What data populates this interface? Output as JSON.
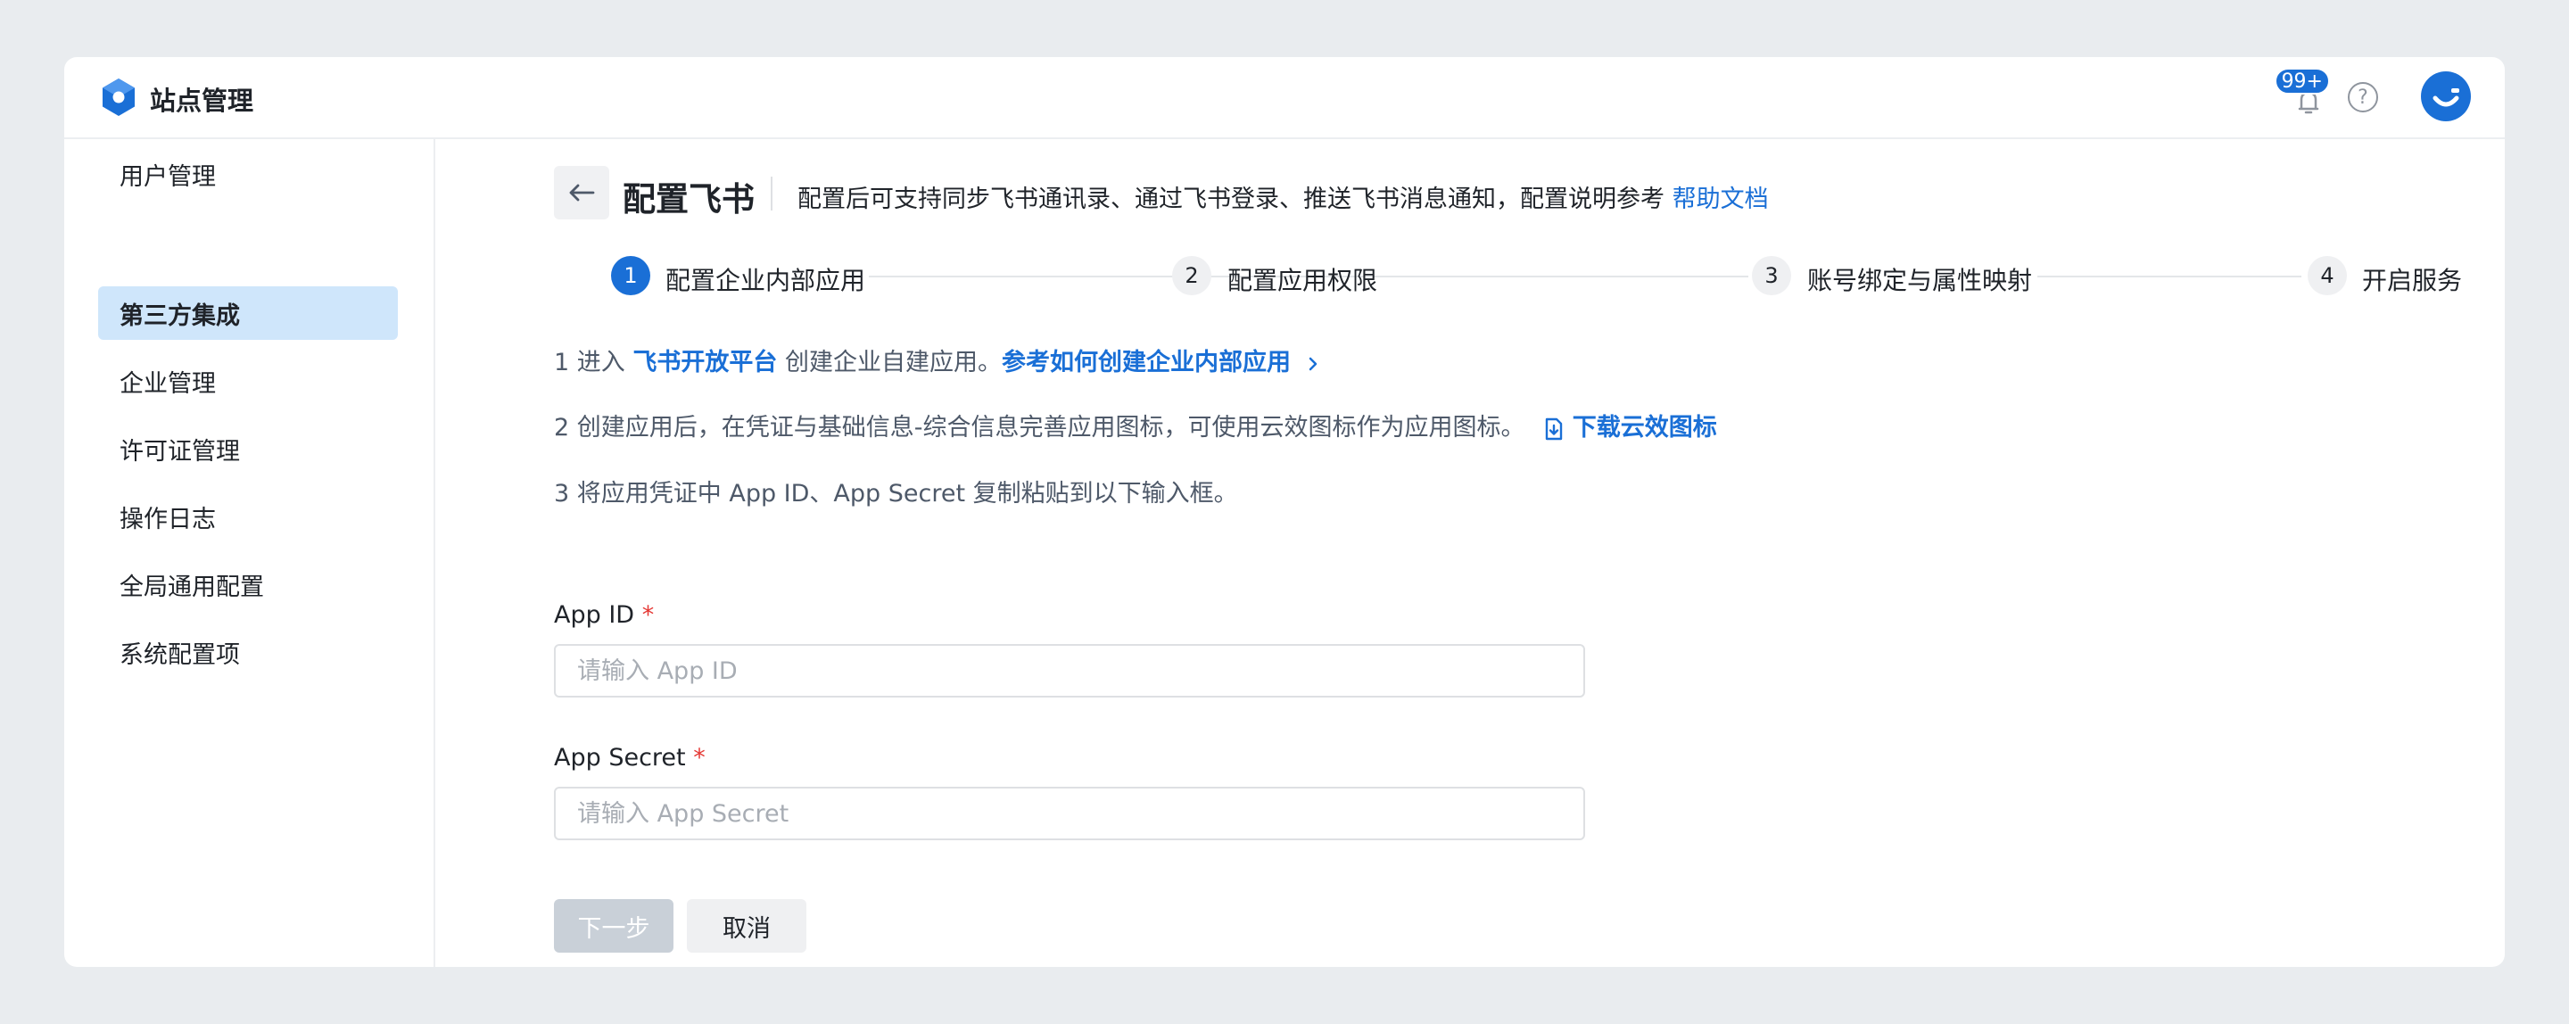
{
  "header": {
    "app_title": "站点管理",
    "notification_badge": "99+"
  },
  "sidebar": {
    "items": [
      {
        "label": "用户管理"
      },
      {
        "label": "第三方集成",
        "active": true
      },
      {
        "label": "企业管理"
      },
      {
        "label": "许可证管理"
      },
      {
        "label": "操作日志"
      },
      {
        "label": "全局通用配置"
      },
      {
        "label": "系统配置项"
      }
    ]
  },
  "page": {
    "title": "配置飞书",
    "description": "配置后可支持同步飞书通讯录、通过飞书登录、推送飞书消息通知，配置说明参考",
    "help_link": "帮助文档"
  },
  "steps": [
    {
      "number": "1",
      "label": "配置企业内部应用",
      "active": true
    },
    {
      "number": "2",
      "label": "配置应用权限"
    },
    {
      "number": "3",
      "label": "账号绑定与属性映射"
    },
    {
      "number": "4",
      "label": "开启服务"
    }
  ],
  "instructions": {
    "line1_prefix": "1 进入",
    "line1_link": "飞书开放平台",
    "line1_mid": "创建企业自建应用。",
    "line1_link2": "参考如何创建企业内部应用",
    "line2_text": "2 创建应用后，在凭证与基础信息-综合信息完善应用图标，可使用云效图标作为应用图标。",
    "line2_link": "下载云效图标",
    "line3_text": "3 将应用凭证中 App ID、App Secret 复制粘贴到以下输入框。"
  },
  "form": {
    "app_id_label": "App ID",
    "app_id_placeholder": "请输入 App ID",
    "app_secret_label": "App Secret",
    "app_secret_placeholder": "请输入 App Secret",
    "required_mark": "*"
  },
  "buttons": {
    "next": "下一步",
    "cancel": "取消"
  },
  "colors": {
    "accent": "#1a6fd6",
    "active_nav_bg": "#cfe6fb",
    "disabled_button": "#c9d0d8",
    "required": "#e53935"
  },
  "icons": {
    "logo": "hexagon-logo-icon",
    "notifications": "bell-icon",
    "help": "question-circle-icon",
    "back": "arrow-left-icon",
    "download": "file-download-icon",
    "chevron": "chevron-right-icon"
  }
}
